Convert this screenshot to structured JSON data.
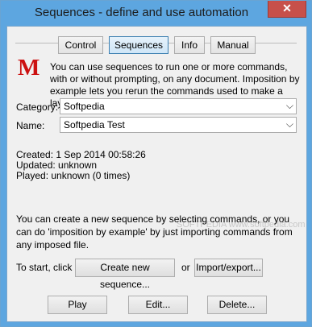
{
  "window": {
    "title": "Sequences - define and use automation",
    "close_glyph": "✕"
  },
  "tabs": [
    {
      "label": "Control",
      "active": false
    },
    {
      "label": "Sequences",
      "active": true
    },
    {
      "label": "Info",
      "active": false
    },
    {
      "label": "Manual",
      "active": false
    }
  ],
  "logo": "M",
  "intro": "You can use sequences to run one or more commands, with or without prompting, on any document. Imposition by example lets you rerun the commands used to make a layout.",
  "category": {
    "label": "Category:",
    "value": "Softpedia"
  },
  "name": {
    "label": "Name:",
    "value": "Softpedia Test"
  },
  "info": {
    "created": "Created:  1 Sep 2014 00:58:26",
    "updated": "Updated: unknown",
    "played": "Played: unknown (0 times)"
  },
  "description": "You can create a new sequence by selecting commands, or you can do 'imposition by example' by just importing commands from any imposed file.",
  "watermark": "SOFTPEDIA www.softpedia.com",
  "start": {
    "label": "To start, click",
    "create_button": "Create new sequence...",
    "or": "or",
    "import_button": "Import/export..."
  },
  "actions": {
    "play": "Play",
    "edit": "Edit...",
    "delete": "Delete..."
  }
}
